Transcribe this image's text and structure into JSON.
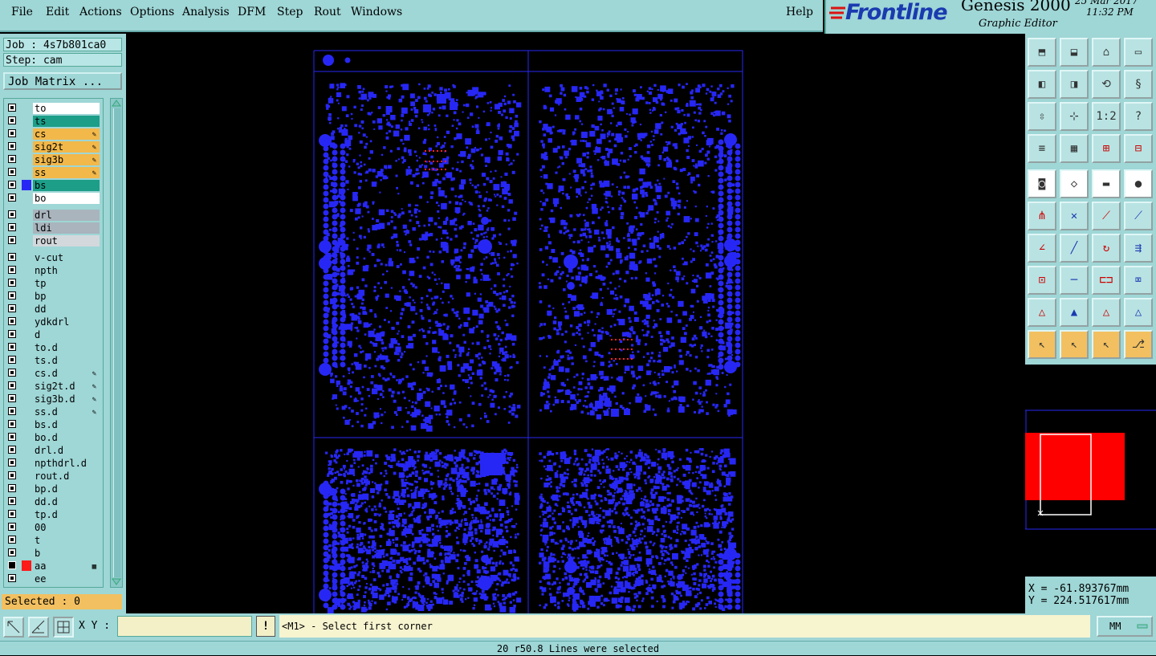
{
  "menu": {
    "file": "File",
    "edit": "Edit",
    "actions": "Actions",
    "options": "Options",
    "analysis": "Analysis",
    "dfm": "DFM",
    "step": "Step",
    "rout": "Rout",
    "windows": "Windows",
    "help": "Help"
  },
  "branding": {
    "logo": "Frontline",
    "product": "Genesis 2000",
    "editor": "Graphic Editor",
    "date": "25 Mar 2017",
    "time": "11:32 PM"
  },
  "job": {
    "job_label": "Job : 4s7b801ca0",
    "step_label": "Step: cam",
    "matrix_button": "Job Matrix ..."
  },
  "layers": [
    {
      "name": "to",
      "bg": "#ffffff",
      "swatch": "",
      "mark": ""
    },
    {
      "name": "ts",
      "bg": "#1c9e88",
      "swatch": "",
      "mark": ""
    },
    {
      "name": "cs",
      "bg": "#f2b84a",
      "swatch": "",
      "mark": "edit"
    },
    {
      "name": "sig2t",
      "bg": "#f2b84a",
      "swatch": "",
      "mark": "edit"
    },
    {
      "name": "sig3b",
      "bg": "#f2b84a",
      "swatch": "",
      "mark": "edit"
    },
    {
      "name": "ss",
      "bg": "#f2b84a",
      "swatch": "",
      "mark": "edit"
    },
    {
      "name": "bs",
      "bg": "#1c9e88",
      "swatch": "#2727f5",
      "mark": ""
    },
    {
      "name": "bo",
      "bg": "#ffffff",
      "swatch": "",
      "mark": ""
    },
    {
      "name": "drl",
      "bg": "#a9b4bd",
      "swatch": "",
      "mark": ""
    },
    {
      "name": "ldi",
      "bg": "#a9b4bd",
      "swatch": "",
      "mark": ""
    },
    {
      "name": "rout",
      "bg": "#d3d8dc",
      "swatch": "",
      "mark": ""
    },
    {
      "name": "v-cut",
      "bg": "#9fd6d6",
      "swatch": "",
      "mark": ""
    },
    {
      "name": "npth",
      "bg": "#9fd6d6",
      "swatch": "",
      "mark": ""
    },
    {
      "name": "tp",
      "bg": "#9fd6d6",
      "swatch": "",
      "mark": ""
    },
    {
      "name": "bp",
      "bg": "#9fd6d6",
      "swatch": "",
      "mark": ""
    },
    {
      "name": "dd",
      "bg": "#9fd6d6",
      "swatch": "",
      "mark": ""
    },
    {
      "name": "ydkdrl",
      "bg": "#9fd6d6",
      "swatch": "",
      "mark": ""
    },
    {
      "name": "d",
      "bg": "#9fd6d6",
      "swatch": "",
      "mark": ""
    },
    {
      "name": "to.d",
      "bg": "#9fd6d6",
      "swatch": "",
      "mark": ""
    },
    {
      "name": "ts.d",
      "bg": "#9fd6d6",
      "swatch": "",
      "mark": ""
    },
    {
      "name": "cs.d",
      "bg": "#9fd6d6",
      "swatch": "",
      "mark": "edit"
    },
    {
      "name": "sig2t.d",
      "bg": "#9fd6d6",
      "swatch": "",
      "mark": "edit"
    },
    {
      "name": "sig3b.d",
      "bg": "#9fd6d6",
      "swatch": "",
      "mark": "edit"
    },
    {
      "name": "ss.d",
      "bg": "#9fd6d6",
      "swatch": "",
      "mark": "edit"
    },
    {
      "name": "bs.d",
      "bg": "#9fd6d6",
      "swatch": "",
      "mark": ""
    },
    {
      "name": "bo.d",
      "bg": "#9fd6d6",
      "swatch": "",
      "mark": ""
    },
    {
      "name": "drl.d",
      "bg": "#9fd6d6",
      "swatch": "",
      "mark": ""
    },
    {
      "name": "npthdrl.d",
      "bg": "#9fd6d6",
      "swatch": "",
      "mark": ""
    },
    {
      "name": "rout.d",
      "bg": "#9fd6d6",
      "swatch": "",
      "mark": ""
    },
    {
      "name": "bp.d",
      "bg": "#9fd6d6",
      "swatch": "",
      "mark": ""
    },
    {
      "name": "dd.d",
      "bg": "#9fd6d6",
      "swatch": "",
      "mark": ""
    },
    {
      "name": "tp.d",
      "bg": "#9fd6d6",
      "swatch": "",
      "mark": ""
    },
    {
      "name": "00",
      "bg": "#9fd6d6",
      "swatch": "",
      "mark": ""
    },
    {
      "name": "t",
      "bg": "#9fd6d6",
      "swatch": "",
      "mark": ""
    },
    {
      "name": "b",
      "bg": "#9fd6d6",
      "swatch": "",
      "mark": ""
    },
    {
      "name": "aa",
      "bg": "#9fd6d6",
      "swatch": "#ff1a1a",
      "mark": "grid"
    },
    {
      "name": "ee",
      "bg": "#9fd6d6",
      "swatch": "",
      "mark": ""
    }
  ],
  "selected_label": "Selected : 0",
  "coords": {
    "x": "X = -61.893767mm",
    "y": "Y = 224.517617mm"
  },
  "xy_label": "X Y :",
  "xy_value": "",
  "warn_label": "!",
  "prompt": "<M1> - Select first corner",
  "units": "MM",
  "status": "20 r50.8 Lines were selected",
  "colors": {
    "panel": "#9fd6d6",
    "pcb_blue": "#2727f5",
    "active_layer": "#1c9e88",
    "edit_layer": "#f2b84a",
    "profile": "#ff0000"
  }
}
